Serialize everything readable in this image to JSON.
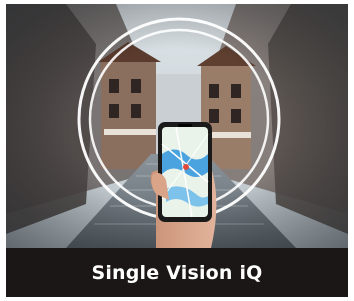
{
  "card": {
    "caption": "Single Vision iQ"
  },
  "colors": {
    "caption_background": "#1b1716",
    "caption_text": "#ffffff",
    "map_water": "#4aa3df",
    "map_land": "#eaf3ea",
    "phone_body": "#1a1a1a"
  },
  "icons": {
    "ring": "circle-outline-icon",
    "map": "map-icon"
  }
}
